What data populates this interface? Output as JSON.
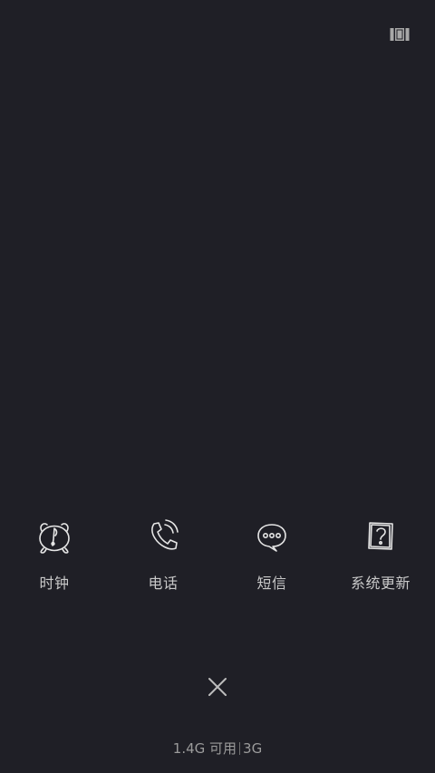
{
  "top_right": {
    "icon": "recent-apps-icon"
  },
  "apps": [
    {
      "label": "时钟",
      "icon": "clock-icon"
    },
    {
      "label": "电话",
      "icon": "phone-icon"
    },
    {
      "label": "短信",
      "icon": "message-icon"
    },
    {
      "label": "系统更新",
      "icon": "system-update-icon"
    }
  ],
  "close": {
    "icon": "close-icon"
  },
  "memory": {
    "available": "1.4G 可用",
    "total": "3G"
  },
  "colors": {
    "background": "#1f1f26",
    "label": "#c9c9c9",
    "icon_stroke": "#e6e6e6",
    "memory_text": "#9b9b9b"
  }
}
